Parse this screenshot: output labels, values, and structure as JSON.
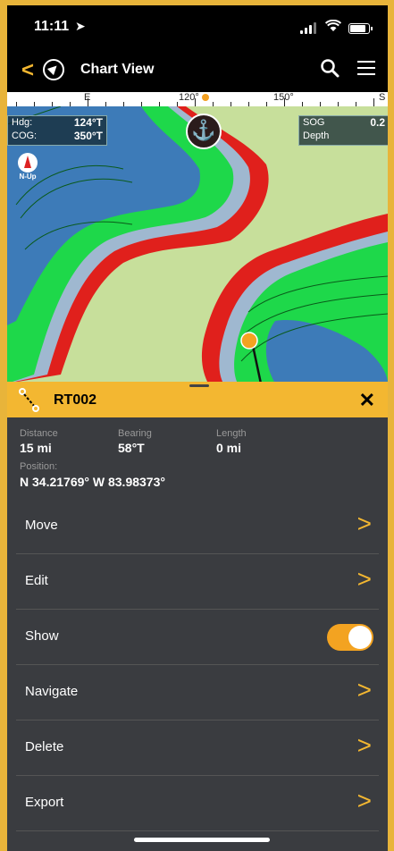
{
  "status": {
    "time": "11:11"
  },
  "nav": {
    "title": "Chart View"
  },
  "ruler": {
    "labels": [
      "E",
      "120°",
      "150°",
      "S"
    ]
  },
  "hud": {
    "hdg_label": "Hdg:",
    "hdg_value": "124°T",
    "cog_label": "COG:",
    "cog_value": "350°T",
    "sog_label": "SOG",
    "sog_value": "0.2",
    "depth_label": "Depth",
    "north_up": "N-Up"
  },
  "route": {
    "name": "RT002",
    "distance_label": "Distance",
    "distance_value": "15 mi",
    "bearing_label": "Bearing",
    "bearing_value": "58°T",
    "length_label": "Length",
    "length_value": "0 mi",
    "position_label": "Position:",
    "position_value": "N 34.21769° W 83.98373°"
  },
  "menu": {
    "move": "Move",
    "edit": "Edit",
    "show": "Show",
    "navigate": "Navigate",
    "delete": "Delete",
    "export": "Export",
    "show_enabled": true
  },
  "colors": {
    "accent": "#f3b731",
    "panel": "#3a3c40",
    "land": "#c7df9b",
    "water": "#3d7bb8",
    "shallow_red": "#e0201c",
    "contour_green": "#1ed84a"
  }
}
